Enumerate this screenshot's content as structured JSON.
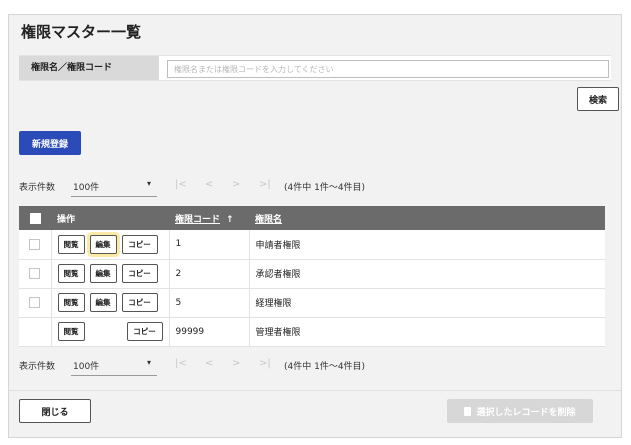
{
  "page": {
    "title": "権限マスター一覧"
  },
  "search": {
    "label": "権限名／権限コード",
    "placeholder": "権限名または権限コードを入力してください",
    "button_label": "検索"
  },
  "toolbar": {
    "new_label": "新規登録"
  },
  "pager": {
    "label": "表示件数",
    "page_size": "100件",
    "count_text": "(4件中 1件〜4件目)",
    "first": "|<",
    "prev": "<",
    "next": ">",
    "last": ">|"
  },
  "table": {
    "headers": {
      "operation": "操作",
      "code": "権限コード",
      "name": "権限名"
    },
    "sort_icon": "arrow-up-icon",
    "button_labels": {
      "view": "閲覧",
      "edit": "編集",
      "copy": "コピー"
    },
    "rows": [
      {
        "code": "1",
        "name": "申請者権限",
        "selectable": true,
        "editable": true
      },
      {
        "code": "2",
        "name": "承認者権限",
        "selectable": true,
        "editable": true
      },
      {
        "code": "5",
        "name": "経理権限",
        "selectable": true,
        "editable": true
      },
      {
        "code": "99999",
        "name": "管理者権限",
        "selectable": false,
        "editable": false
      }
    ]
  },
  "footer": {
    "close_label": "閉じる",
    "delete_label": "選択したレコードを削除"
  },
  "colors": {
    "primary": "#2a4bb8",
    "header_bg": "#6b6b6b",
    "highlight": "#fce9a8"
  }
}
